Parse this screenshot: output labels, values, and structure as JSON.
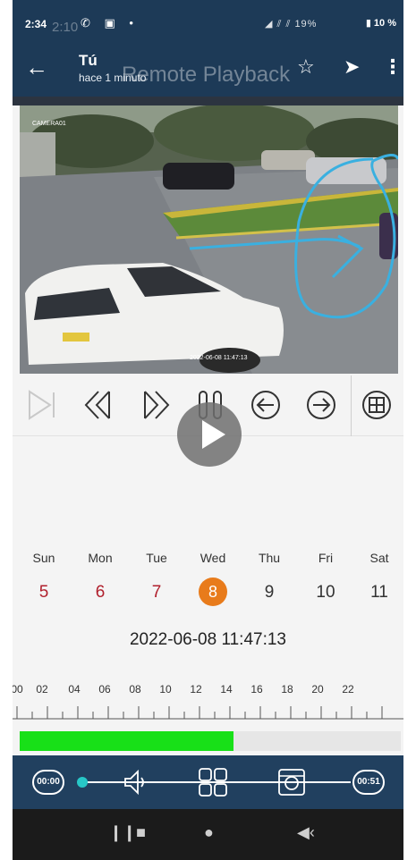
{
  "status_bar": {
    "time": "2:34",
    "ghost_time": "2:10",
    "left_icons": "✆ ▣ •",
    "right_icons": "◢ ⫽ ⫽ 19%",
    "battery": "▮ 10 %"
  },
  "header": {
    "chat_title": "Tú",
    "chat_subtitle": "hace 1 minuto",
    "overlay_title": "Remote Playback"
  },
  "video": {
    "camera_label": "CAMERA01",
    "timestamp_overlay": "2022-06-08 11:47:13"
  },
  "playback_controls": [
    {
      "name": "next-frame",
      "icon": "next-frame-icon"
    },
    {
      "name": "rewind",
      "icon": "rewind-icon"
    },
    {
      "name": "fast-forward",
      "icon": "fast-forward-icon"
    },
    {
      "name": "pause",
      "icon": "pause-icon"
    },
    {
      "name": "previous",
      "icon": "circle-left-arrow-icon"
    },
    {
      "name": "next",
      "icon": "circle-right-arrow-icon"
    },
    {
      "name": "layout",
      "icon": "grid-layout-icon"
    }
  ],
  "calendar": {
    "week_labels": [
      "Sun",
      "Mon",
      "Tue",
      "Wed",
      "Thu",
      "Fri",
      "Sat"
    ],
    "days": [
      {
        "label": "5",
        "state": "red"
      },
      {
        "label": "6",
        "state": "red"
      },
      {
        "label": "7",
        "state": "red"
      },
      {
        "label": "8",
        "state": "selected"
      },
      {
        "label": "9",
        "state": "normal"
      },
      {
        "label": "10",
        "state": "normal"
      },
      {
        "label": "11",
        "state": "normal"
      }
    ],
    "selected_datetime": "2022-06-08 11:47:13"
  },
  "timeline": {
    "hour_labels": [
      "00",
      "02",
      "04",
      "06",
      "08",
      "10",
      "12",
      "14",
      "16",
      "18",
      "20",
      "22"
    ],
    "recorded_fraction": 0.56,
    "record_color": "#18e018"
  },
  "bottom_toolbar": {
    "start_time": "00:00",
    "end_time": "00:51",
    "progress_fraction": 0.0
  },
  "colors": {
    "header_bg": "#1d3a57",
    "selected_day": "#e87b1b",
    "weekend_day": "#b01f2c",
    "annotation_stroke": "#3ab0e0"
  }
}
